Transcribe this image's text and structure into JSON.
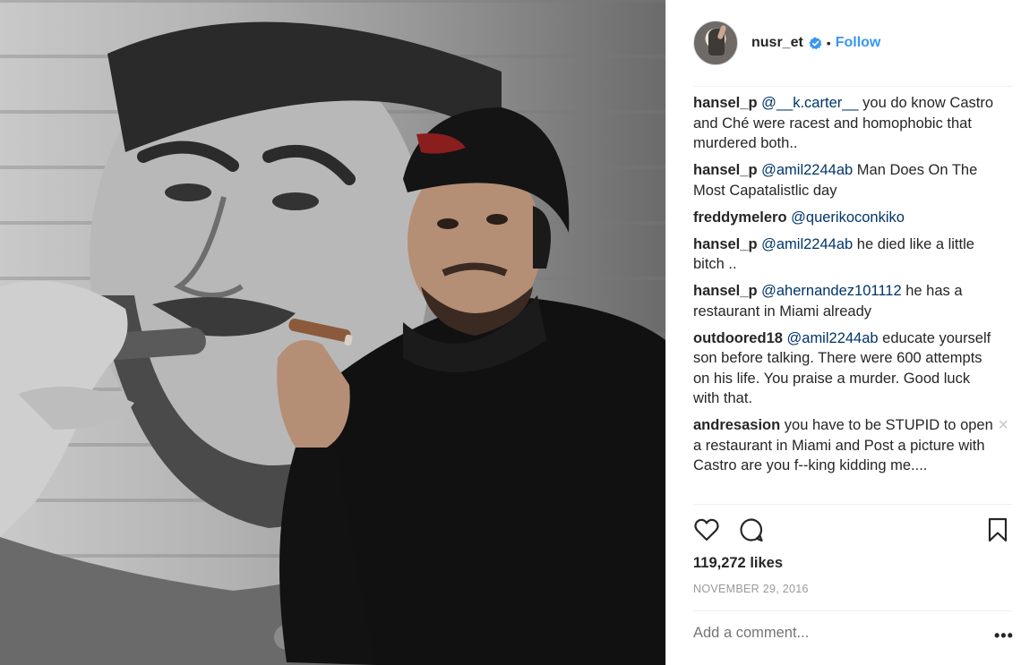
{
  "post": {
    "username": "nusr_et",
    "verified_icon": "verified-badge-icon",
    "separator": "•",
    "follow_label": "Follow",
    "likes": "119,272 likes",
    "date": "NOVEMBER 29, 2016",
    "add_comment_placeholder": "Add a comment...",
    "more_options": "•••"
  },
  "comments": [
    {
      "user": "hansel_p",
      "mention": "@__k.carter__",
      "text": " you do know Castro and Ché were racest and homophobic that murdered both.."
    },
    {
      "user": "hansel_p",
      "mention": "@amil2244ab",
      "text": " Man Does On The Most Capatalistlic day"
    },
    {
      "user": "freddymelero",
      "mention": "@querikoconkiko",
      "text": ""
    },
    {
      "user": "hansel_p",
      "mention": "@amil2244ab",
      "text": " he died like a little bitch .."
    },
    {
      "user": "hansel_p",
      "mention": "@ahernandez101112",
      "text": " he has a restaurant in Miami already"
    },
    {
      "user": "outdoored18",
      "mention": "@amil2244ab",
      "text": " educate yourself son before talking. There were 600 attempts on his life. You praise a murder. Good luck with that."
    },
    {
      "user": "andresasion",
      "mention": "",
      "text": " you have to be STUPID to open a restaurant in Miami and Post a picture with Castro are you f--king kidding me....",
      "close": "×"
    }
  ],
  "icons": {
    "like": "heart-icon",
    "comment": "comment-bubble-icon",
    "save": "bookmark-icon"
  },
  "colors": {
    "link": "#3897f0",
    "mention": "#003569",
    "muted": "#999999"
  }
}
